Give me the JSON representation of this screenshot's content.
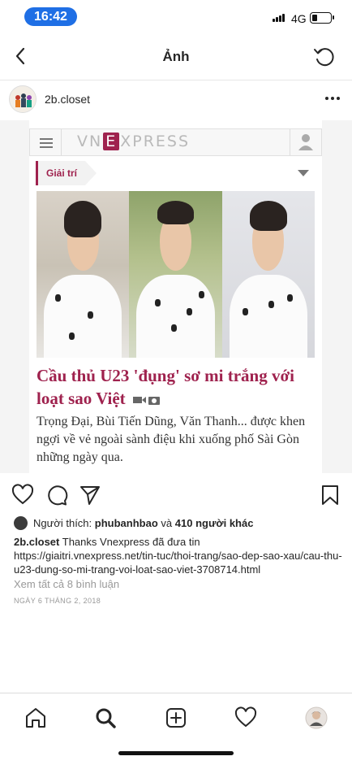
{
  "status_bar": {
    "time": "16:42",
    "network": "4G",
    "battery_level": 0.3
  },
  "nav": {
    "title": "Ảnh",
    "back_icon": "chevron-left-icon",
    "refresh_icon": "refresh-icon"
  },
  "post": {
    "username": "2b.closet",
    "more_icon": "more-horizontal-icon",
    "image": {
      "site_logo_left": "VN",
      "site_logo_mid": "E",
      "site_logo_right": "XPRESS",
      "category": "Giải trí",
      "headline": "Cầu thủ U23 'đụng' sơ mi trắng với loạt sao Việt",
      "lead": "Trọng Đại, Bùi Tiến Dũng, Văn Thanh... được khen ngợi về vẻ ngoài sành điệu khi xuống phố Sài Gòn những ngày qua."
    },
    "likes": {
      "prefix": "Người thích:",
      "user": "phubanhbao",
      "conj": "và",
      "others": "410 người khác"
    },
    "caption": {
      "username": "2b.closet",
      "text": "Thanks Vnexpress đã đưa tin",
      "url": "https://giaitri.vnexpress.net/tin-tuc/thoi-trang/sao-dep-sao-xau/cau-thu-u23-dung-so-mi-trang-voi-loat-sao-viet-3708714.html"
    },
    "view_comments": "Xem tất cả 8 bình luận",
    "date": "NGÀY 6 THÁNG 2, 2018"
  },
  "actions": [
    "heart-icon",
    "comment-icon",
    "share-icon",
    "bookmark-icon"
  ],
  "tabs": [
    "home-icon",
    "search-icon",
    "add-post-icon",
    "activity-icon",
    "profile-icon"
  ]
}
